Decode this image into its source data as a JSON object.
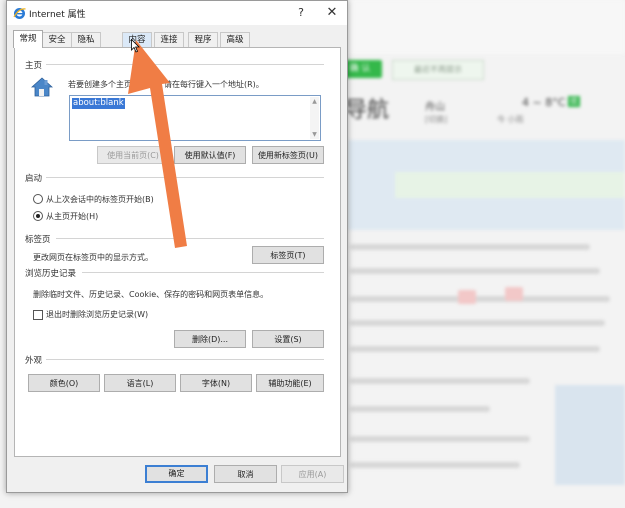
{
  "background": {
    "confirm_label": "确 认",
    "no_prompt_label": "最近不再提示",
    "site_title": "导航",
    "city": "舟山",
    "city_sub": "[切换]",
    "temperature": "4 ~ 8°C",
    "air_quality": "优",
    "weather": "今  小雨"
  },
  "dialog": {
    "title": "Internet 属性",
    "help": "?",
    "close": "✕",
    "tabs": [
      "常规",
      "安全",
      "隐私",
      "内容",
      "连接",
      "程序",
      "高级"
    ],
    "active_tab": "常规",
    "home": {
      "section": "主页",
      "desc": "若要创建多个主页选项卡，请在每行键入一个地址(R)。",
      "url_value": "about:blank",
      "use_current": "使用当前页(C)",
      "use_default": "使用默认值(F)",
      "use_new_tab": "使用新标签页(U)"
    },
    "startup": {
      "section": "启动",
      "option1": "从上次会话中的标签页开始(B)",
      "option2": "从主页开始(H)",
      "selected": "从主页开始(H)"
    },
    "tabs_section": {
      "section": "标签页",
      "desc": "更改网页在标签页中的显示方式。",
      "button": "标签页(T)"
    },
    "history": {
      "section": "浏览历史记录",
      "desc": "删除临时文件、历史记录、Cookie、保存的密码和网页表单信息。",
      "checkbox": "退出时删除浏览历史记录(W)",
      "delete": "删除(D)...",
      "settings": "设置(S)"
    },
    "appearance": {
      "section": "外观",
      "colors": "颜色(O)",
      "languages": "语言(L)",
      "fonts": "字体(N)",
      "accessibility": "辅助功能(E)"
    },
    "footer": {
      "ok": "确定",
      "cancel": "取消",
      "apply": "应用(A)"
    }
  },
  "colors": {
    "arrow": "#f07d45",
    "selection": "#3a78d6",
    "default_button_border": "#3c7fd3"
  }
}
